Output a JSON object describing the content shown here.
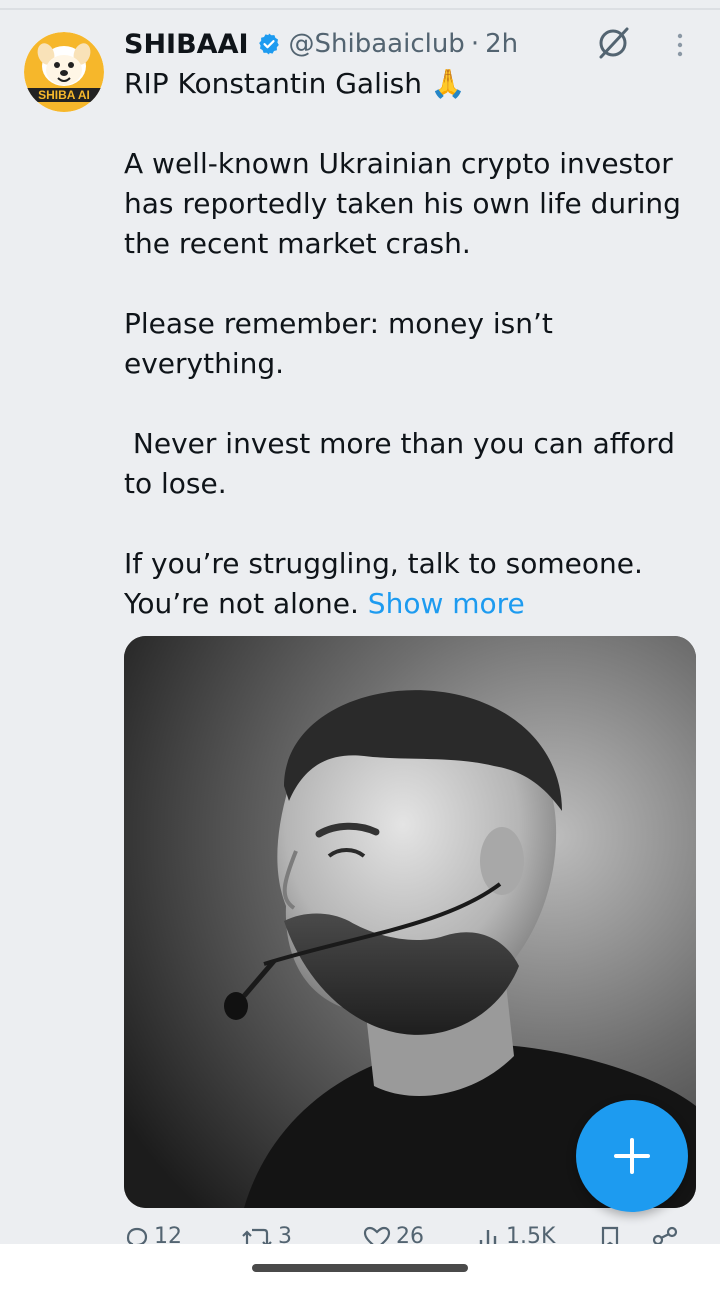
{
  "tweet": {
    "display_name": "SHIBAAI",
    "handle": "@Shibaaiclub",
    "separator": "·",
    "time": "2h",
    "avatar_logo_text": "SHIBA AI",
    "lines": [
      "RIP Konstantin Galish 🙏",
      "A well-known Ukrainian crypto investor has reportedly taken his own life during the recent market crash.",
      "Please remember: money isn’t everything.",
      " Never invest more than you can afford to lose.",
      "If you’re struggling, talk to someone. You’re not alone."
    ],
    "show_more": "Show more",
    "media_description": "black-and-white portrait photo"
  },
  "actions": {
    "replies": "12",
    "reposts": "3",
    "likes": "26",
    "views": "1.5K"
  },
  "icons": {
    "verified": "verified-badge-icon",
    "grok": "grok-icon",
    "more": "more-vertical-icon",
    "reply": "reply-icon",
    "repost": "repost-icon",
    "like": "like-icon",
    "views": "views-icon",
    "bookmark": "bookmark-icon",
    "share": "share-icon",
    "compose": "plus-icon"
  },
  "colors": {
    "accent": "#1d9bf0",
    "background": "#eceef1",
    "text": "#0f1419",
    "muted": "#536471"
  }
}
